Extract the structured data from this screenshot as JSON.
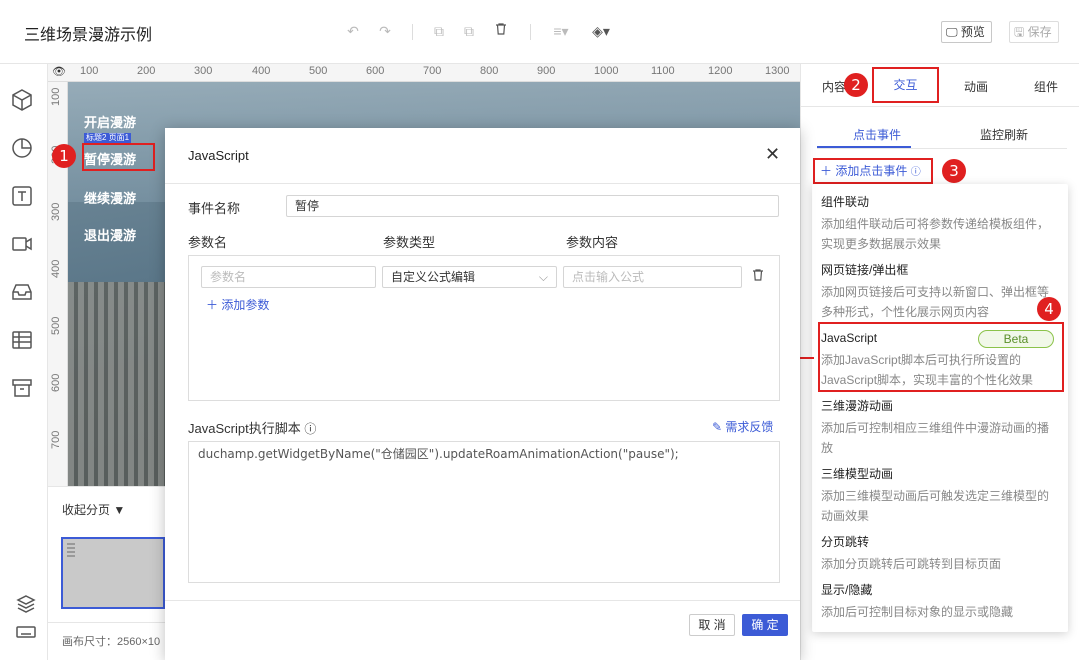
{
  "app": {
    "title": "三维场景漫游示例"
  },
  "toolbar": {
    "preview_label": "预览",
    "save_label": "保存"
  },
  "ruler": {
    "top_ticks": [
      "100",
      "200",
      "300",
      "400",
      "500",
      "600",
      "700",
      "800",
      "900",
      "1000",
      "1100",
      "1200",
      "1300"
    ],
    "left_ticks": [
      "100",
      "200",
      "300",
      "400",
      "500",
      "600",
      "700"
    ]
  },
  "canvas": {
    "menu": [
      "开启漫游",
      "暂停漫游",
      "继续漫游",
      "退出漫游"
    ],
    "selection_label": "标题2 页面1"
  },
  "pages": {
    "toggle_label": "收起分页",
    "canvas_size": "画布尺寸：2560×10"
  },
  "right_panel": {
    "tabs": [
      "内容",
      "交互",
      "动画",
      "组件"
    ],
    "subtabs": [
      "点击事件",
      "监控刷新"
    ],
    "add_event_label": "添加点击事件"
  },
  "event_menu": {
    "items": [
      {
        "title": "组件联动",
        "desc": "添加组件联动后可将参数传递给模板组件，实现更多数据展示效果"
      },
      {
        "title": "网页链接/弹出框",
        "desc": "添加网页链接后可支持以新窗口、弹出框等多种形式，个性化展示网页内容"
      },
      {
        "title": "JavaScript",
        "desc": "添加JavaScript脚本后可执行所设置的JavaScript脚本，实现丰富的个性化效果",
        "badge": "Beta"
      },
      {
        "title": "三维漫游动画",
        "desc": "添加后可控制相应三维组件中漫游动画的播放"
      },
      {
        "title": "三维模型动画",
        "desc": "添加三维模型动画后可触发选定三维模型的动画效果"
      },
      {
        "title": "分页跳转",
        "desc": "添加分页跳转后可跳转到目标页面"
      },
      {
        "title": "显示/隐藏",
        "desc": "添加后可控制目标对象的显示或隐藏"
      }
    ]
  },
  "dialog": {
    "title": "JavaScript",
    "event_name_label": "事件名称",
    "event_name_value": "暂停",
    "param_headers": [
      "参数名",
      "参数类型",
      "参数内容"
    ],
    "param_name_placeholder": "参数名",
    "param_type_value": "自定义公式编辑",
    "param_content_placeholder": "点击输入公式",
    "add_param_label": "添加参数",
    "script_label": "JavaScript执行脚本",
    "feedback_label": "需求反馈",
    "script_code": "duchamp.getWidgetByName(\"仓储园区\").updateRoamAnimationAction(\"pause\");",
    "cancel_label": "取 消",
    "ok_label": "确 定"
  },
  "markers": [
    "1",
    "2",
    "3",
    "4"
  ],
  "colors": {
    "accent": "#3c5bd6",
    "highlight": "#e02020",
    "beta": "#8bc34a"
  }
}
